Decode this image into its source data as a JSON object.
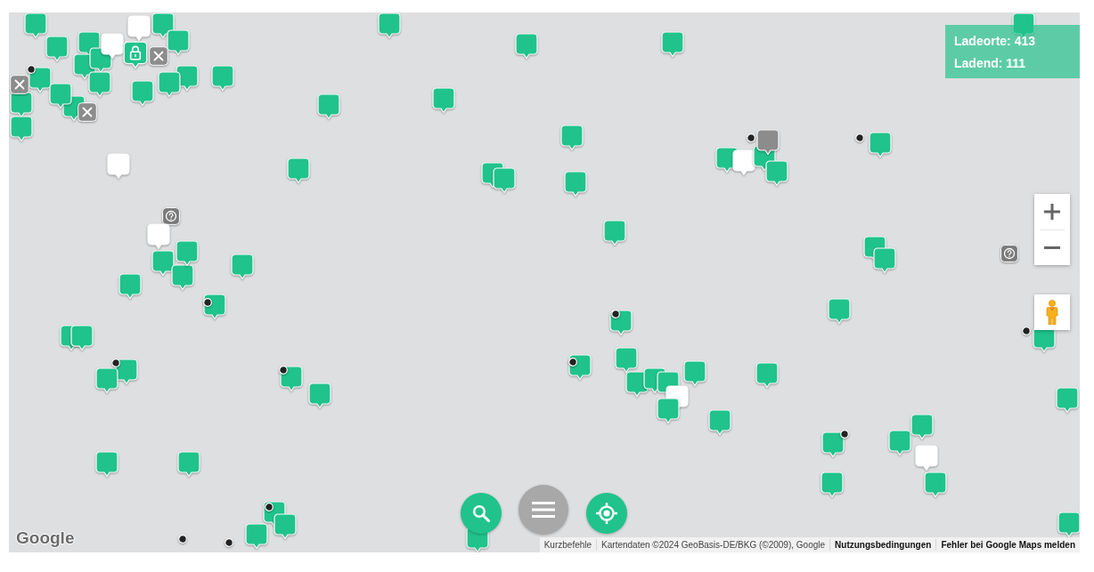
{
  "info_box": {
    "lines": [
      "Ladeorte: 413",
      "Ladend: 111"
    ]
  },
  "map": {
    "markers": [
      {
        "kind": "station",
        "color": "#20c38b"
      },
      {
        "kind": "station",
        "color": "#20c38b"
      },
      {
        "kind": "station",
        "color": "#20c38b"
      },
      {
        "kind": "station",
        "color": "#20c38b"
      },
      {
        "kind": "station",
        "color": "#20c38b"
      },
      {
        "kind": "station",
        "color": "#20c38b"
      },
      {
        "kind": "station",
        "color": "#20c38b"
      },
      {
        "kind": "station",
        "color": "#20c38b"
      },
      {
        "kind": "station",
        "color": "#20c38b"
      },
      {
        "kind": "station",
        "color": "#20c38b"
      },
      {
        "kind": "station",
        "color": "#20c38b"
      },
      {
        "kind": "station",
        "color": "#20c38b"
      },
      {
        "kind": "station",
        "color": "#20c38b"
      },
      {
        "kind": "station",
        "color": "#20c38b"
      },
      {
        "kind": "station",
        "color": "#20c38b"
      },
      {
        "kind": "station",
        "color": "#20c38b"
      },
      {
        "kind": "station",
        "color": "#20c38b"
      },
      {
        "kind": "station",
        "color": "#ffffff"
      },
      {
        "kind": "station",
        "color": "#ffffff"
      },
      {
        "kind": "locked",
        "color": "#20c38b"
      },
      {
        "kind": "closed",
        "color": "#8c8c8c"
      },
      {
        "kind": "closed",
        "color": "#8c8c8c"
      },
      {
        "kind": "closed",
        "color": "#8c8c8c"
      },
      {
        "kind": "station",
        "color": "#20c38b"
      },
      {
        "kind": "station",
        "color": "#20c38b"
      },
      {
        "kind": "station",
        "color": "#20c38b"
      },
      {
        "kind": "station",
        "color": "#20c38b"
      },
      {
        "kind": "station",
        "color": "#20c38b"
      },
      {
        "kind": "station",
        "color": "#20c38b"
      },
      {
        "kind": "station",
        "color": "#20c38b"
      },
      {
        "kind": "station",
        "color": "#20c38b"
      },
      {
        "kind": "station",
        "color": "#20c38b"
      },
      {
        "kind": "station",
        "color": "#20c38b"
      },
      {
        "kind": "station",
        "color": "#20c38b"
      },
      {
        "kind": "station",
        "color": "#ffffff"
      },
      {
        "kind": "station",
        "color": "#20c38b"
      },
      {
        "kind": "station",
        "color": "#ffffff"
      },
      {
        "kind": "station",
        "color": "#20c38b"
      },
      {
        "kind": "station",
        "color": "#8c8c8c"
      },
      {
        "kind": "station",
        "color": "#20c38b"
      },
      {
        "kind": "station",
        "color": "#20c38b"
      },
      {
        "kind": "station",
        "color": "#20c38b"
      },
      {
        "kind": "station",
        "color": "#20c38b"
      },
      {
        "kind": "station",
        "color": "#20c38b"
      },
      {
        "kind": "unknown",
        "color": "#7a7a7a"
      },
      {
        "kind": "station",
        "color": "#ffffff"
      },
      {
        "kind": "station",
        "color": "#20c38b"
      },
      {
        "kind": "station",
        "color": "#20c38b"
      },
      {
        "kind": "station",
        "color": "#20c38b"
      },
      {
        "kind": "station",
        "color": "#20c38b"
      },
      {
        "kind": "station",
        "color": "#20c38b"
      },
      {
        "kind": "station",
        "color": "#20c38b"
      },
      {
        "kind": "station",
        "color": "#20c38b"
      },
      {
        "kind": "station",
        "color": "#20c38b"
      },
      {
        "kind": "station",
        "color": "#20c38b"
      },
      {
        "kind": "station",
        "color": "#20c38b"
      },
      {
        "kind": "station",
        "color": "#20c38b"
      },
      {
        "kind": "station",
        "color": "#20c38b"
      },
      {
        "kind": "station",
        "color": "#20c38b"
      },
      {
        "kind": "unknown",
        "color": "#7a7a7a"
      },
      {
        "kind": "station",
        "color": "#20c38b"
      },
      {
        "kind": "station",
        "color": "#20c38b"
      },
      {
        "kind": "station",
        "color": "#20c38b"
      },
      {
        "kind": "station",
        "color": "#20c38b"
      },
      {
        "kind": "station",
        "color": "#20c38b"
      },
      {
        "kind": "station",
        "color": "#20c38b"
      },
      {
        "kind": "station",
        "color": "#20c38b"
      },
      {
        "kind": "station",
        "color": "#ffffff"
      },
      {
        "kind": "station",
        "color": "#20c38b"
      },
      {
        "kind": "station",
        "color": "#20c38b"
      },
      {
        "kind": "station",
        "color": "#20c38b"
      },
      {
        "kind": "station",
        "color": "#20c38b"
      },
      {
        "kind": "station",
        "color": "#20c38b"
      },
      {
        "kind": "station",
        "color": "#20c38b"
      },
      {
        "kind": "station",
        "color": "#20c38b"
      },
      {
        "kind": "station",
        "color": "#ffffff"
      },
      {
        "kind": "station",
        "color": "#20c38b"
      },
      {
        "kind": "station",
        "color": "#20c38b"
      },
      {
        "kind": "station",
        "color": "#20c38b"
      },
      {
        "kind": "station",
        "color": "#20c38b"
      },
      {
        "kind": "station",
        "color": "#20c38b"
      },
      {
        "kind": "station",
        "color": "#20c38b"
      },
      {
        "kind": "station",
        "color": "#20c38b"
      },
      {
        "kind": "station",
        "color": "#20c38b"
      },
      {
        "kind": "station",
        "color": "#20c38b"
      },
      {
        "kind": "station",
        "color": "#20c38b"
      },
      {
        "kind": "point",
        "color": "#222222"
      },
      {
        "kind": "point",
        "color": "#222222"
      },
      {
        "kind": "point",
        "color": "#222222"
      },
      {
        "kind": "point",
        "color": "#222222"
      },
      {
        "kind": "point",
        "color": "#222222"
      },
      {
        "kind": "point",
        "color": "#222222"
      },
      {
        "kind": "point",
        "color": "#222222"
      },
      {
        "kind": "point",
        "color": "#222222"
      },
      {
        "kind": "point",
        "color": "#222222"
      },
      {
        "kind": "point",
        "color": "#222222"
      },
      {
        "kind": "point",
        "color": "#222222"
      },
      {
        "kind": "point",
        "color": "#222222"
      },
      {
        "kind": "point",
        "color": "#222222"
      }
    ]
  },
  "logo": "Google",
  "attribution": [
    {
      "text": "Kurzbefehle",
      "bold": false
    },
    {
      "text": "Kartendaten ©2024 GeoBasis-DE/BKG (©2009), Google",
      "bold": false
    },
    {
      "text": "Nutzungsbedingungen",
      "bold": true
    },
    {
      "text": "Fehler bei Google Maps melden",
      "bold": true
    }
  ]
}
